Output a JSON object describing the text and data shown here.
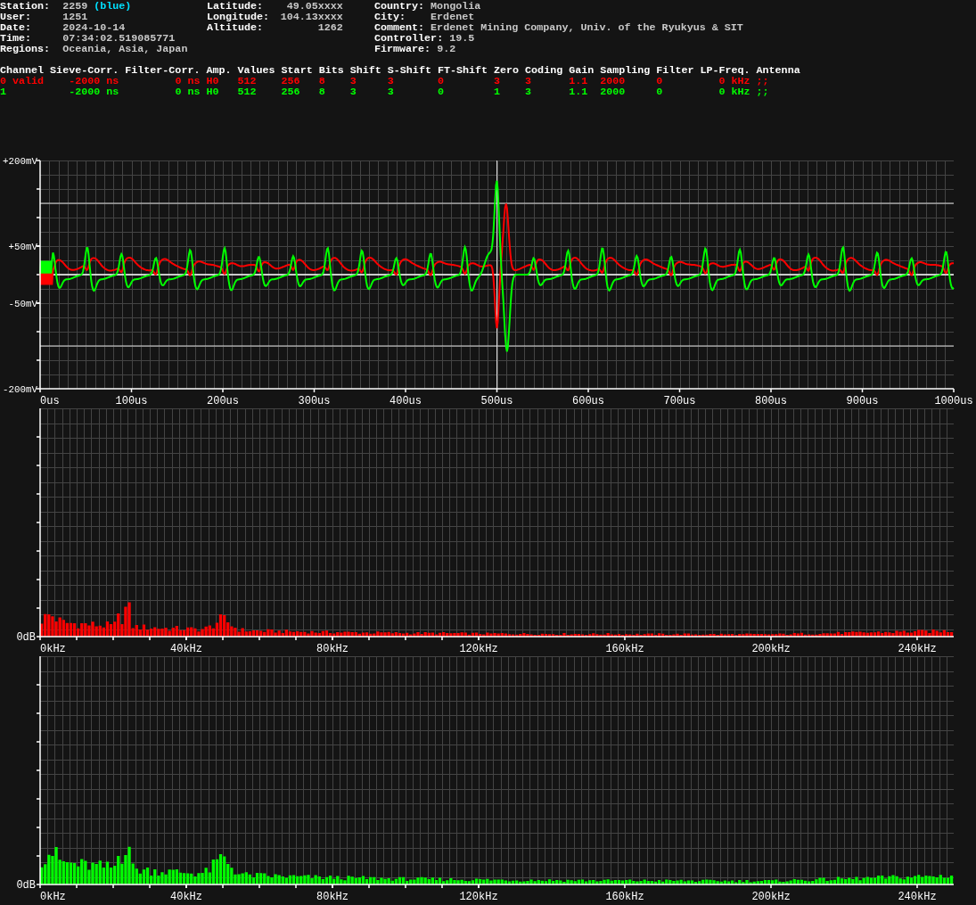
{
  "info_columns": [
    [
      {
        "label": "Station:",
        "value": "2259",
        "tag": "(blue)"
      },
      {
        "label": "User:",
        "value": "1251"
      },
      {
        "label": "Date:",
        "value": "2024-10-14"
      },
      {
        "label": "Time:",
        "value": "07:34:02.519085771"
      },
      {
        "label": "Regions:",
        "value": "Oceania, Asia, Japan"
      }
    ],
    [
      {
        "label": "Latitude:",
        "value": "49.05xxxx"
      },
      {
        "label": "Longitude:",
        "value": "104.13xxxx"
      },
      {
        "label": "Altitude:",
        "value": "1262"
      }
    ],
    [
      {
        "label": "Country:",
        "value": "Mongolia"
      },
      {
        "label": "City:",
        "value": "Erdenet"
      },
      {
        "label": "Comment:",
        "value": "Erdenet Mining Company, Univ. of the Ryukyus & SIT"
      },
      {
        "label": "Controller:",
        "value": "19.5"
      },
      {
        "label": "Firmware:",
        "value": "9.2"
      }
    ]
  ],
  "channel_table": {
    "columns": [
      "Channel",
      "Sieve-Corr.",
      "Filter-Corr.",
      "Amp.",
      "Values",
      "Start",
      "Bits",
      "Shift",
      "S-Shift",
      "FT-Shift",
      "Zero",
      "Coding",
      "Gain",
      "Sampling",
      "Filter",
      "LP-Freq.",
      "Antenna"
    ],
    "rows": [
      {
        "color": "#ff0000",
        "cells": [
          "0 valid",
          "-2000 ns",
          "0 ns",
          "H0",
          "512",
          "256",
          "8",
          "3",
          "3",
          "0",
          "3",
          "3",
          "1.1",
          "2000",
          "0",
          "0 kHz",
          ";;"
        ]
      },
      {
        "color": "#00ff00",
        "cells": [
          "1",
          "-2000 ns",
          "0 ns",
          "H0",
          "512",
          "256",
          "8",
          "3",
          "3",
          "0",
          "1",
          "3",
          "1.1",
          "2000",
          "0",
          "0 kHz",
          ";;"
        ]
      }
    ]
  },
  "waveform": {
    "y_labels": [
      "+200mV",
      "+50mV",
      "-50mV",
      "-200mV"
    ],
    "x_labels": [
      "0us",
      "100us",
      "200us",
      "300us",
      "400us",
      "500us",
      "600us",
      "700us",
      "800us",
      "900us",
      "1000us"
    ]
  },
  "spectra": [
    {
      "color": "#ff0000",
      "y_label": "0dB",
      "x_labels": [
        "0kHz",
        "40kHz",
        "80kHz",
        "120kHz",
        "160kHz",
        "200kHz",
        "240kHz"
      ]
    },
    {
      "color": "#00ff00",
      "y_label": "0dB",
      "x_labels": [
        "0kHz",
        "40kHz",
        "80kHz",
        "120kHz",
        "160kHz",
        "200kHz",
        "240kHz"
      ]
    }
  ]
}
